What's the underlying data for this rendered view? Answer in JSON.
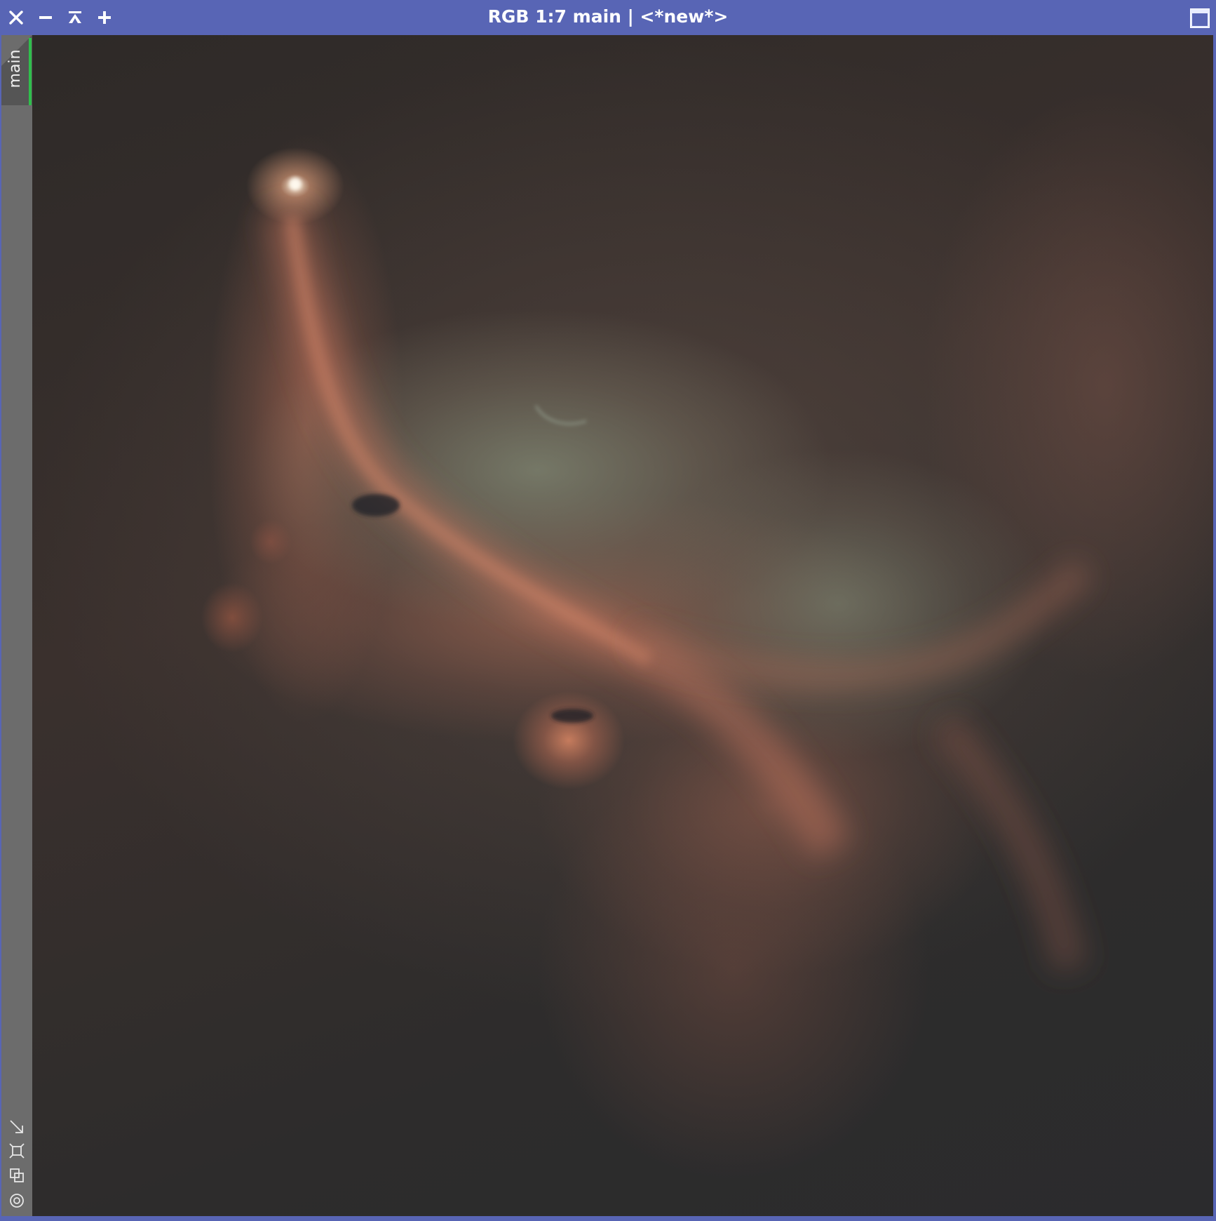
{
  "window": {
    "title": "RGB 1:7 main | <*new*>",
    "frame_color": "#5865b5"
  },
  "titlebar": {
    "buttons": [
      {
        "name": "close",
        "icon": "close-icon"
      },
      {
        "name": "minimize",
        "icon": "minimize-icon"
      },
      {
        "name": "shade",
        "icon": "shade-icon"
      },
      {
        "name": "maximize",
        "icon": "plus-icon"
      }
    ],
    "right_button": {
      "name": "restore",
      "icon": "window-icon"
    }
  },
  "side_panel": {
    "view_tab": {
      "label": "main",
      "accent_color": "#2fbf4b"
    },
    "tools": [
      {
        "name": "resize",
        "icon": "diagonal-arrow-icon"
      },
      {
        "name": "fit",
        "icon": "fit-view-icon"
      },
      {
        "name": "clone",
        "icon": "clone-icon"
      },
      {
        "name": "target",
        "icon": "target-icon"
      }
    ]
  },
  "image": {
    "description_colors": {
      "background": "#2d2b2b",
      "nebula_red": "#b06a55",
      "nebula_teal": "#7f8672"
    }
  }
}
